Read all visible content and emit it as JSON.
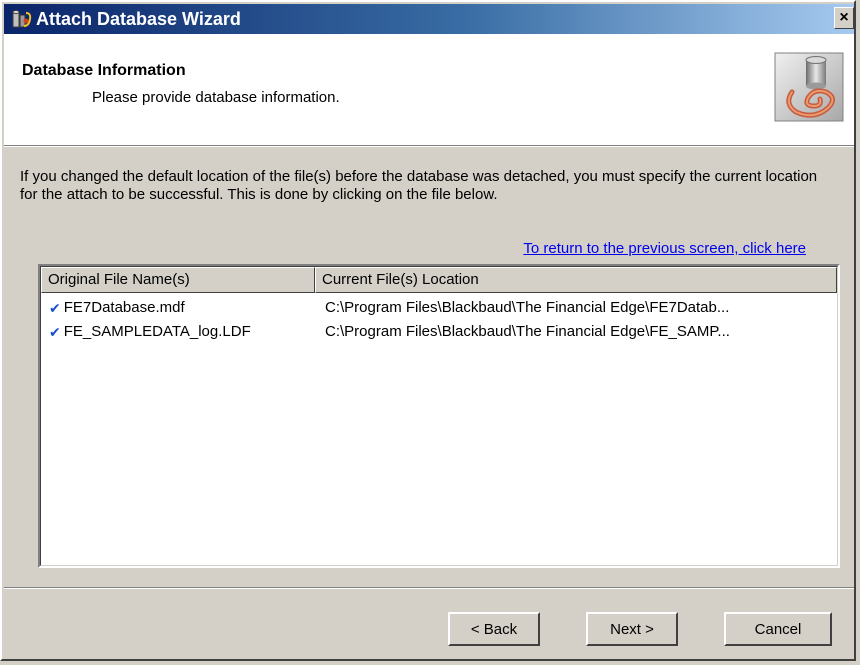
{
  "window": {
    "title": "Attach Database Wizard",
    "title_icon": "database-attach-icon",
    "close_label": "×"
  },
  "header": {
    "title": "Database Information",
    "subtitle": "Please provide database information.",
    "image": "database-wizard-icon"
  },
  "body": {
    "instructions": "If you changed the default location of the file(s) before the database was detached, you must specify the current location for the attach to be successful. This is done by clicking on the file below.",
    "return_link": "To return to the previous screen, click here"
  },
  "file_list": {
    "columns": [
      "Original File Name(s)",
      "Current File(s) Location"
    ],
    "rows": [
      {
        "name": "FE7Database.mdf",
        "location": "C:\\Program Files\\Blackbaud\\The Financial Edge\\FE7Datab...",
        "checked": true
      },
      {
        "name": "FE_SAMPLEDATA_log.LDF",
        "location": "C:\\Program Files\\Blackbaud\\The Financial Edge\\FE_SAMP...",
        "checked": true
      }
    ],
    "check_glyph": "✔"
  },
  "buttons": {
    "back": "< Back",
    "next": "Next >",
    "cancel": "Cancel"
  },
  "colors": {
    "titlebar_start": "#0a246a",
    "titlebar_end": "#a6caf0",
    "link": "#0000ee",
    "check": "#1a4fd0",
    "face": "#d4d0c8"
  }
}
